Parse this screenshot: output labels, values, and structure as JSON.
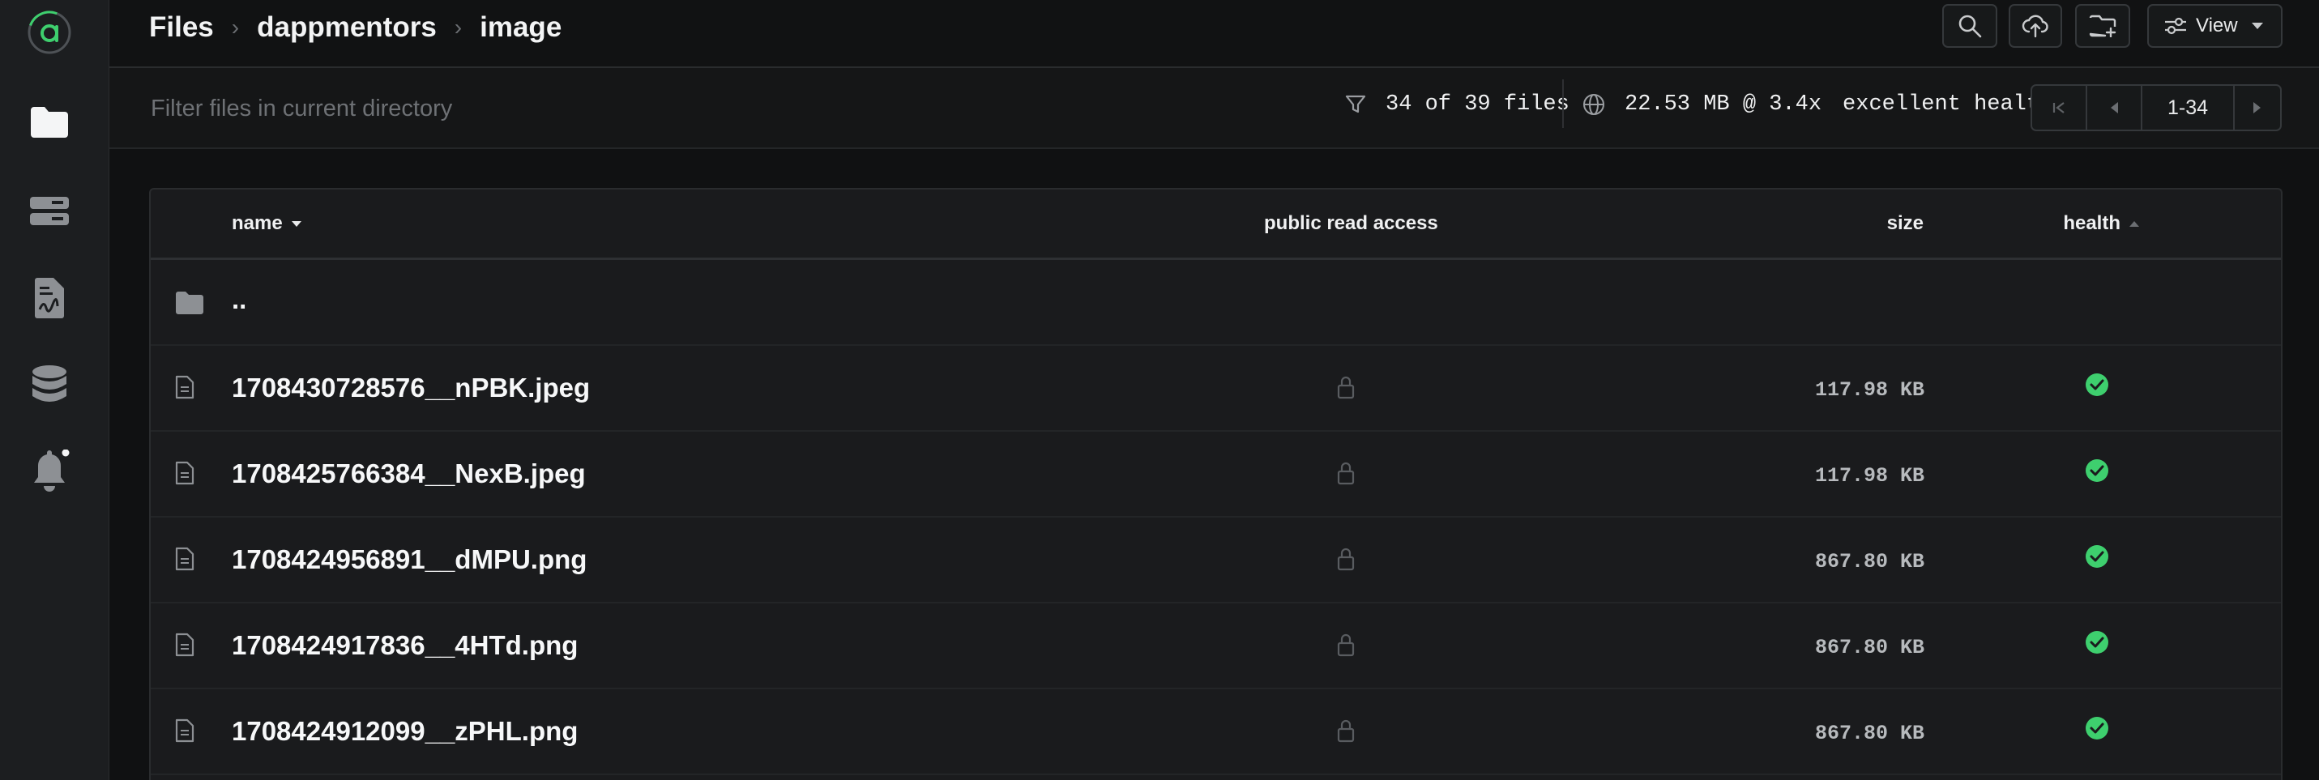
{
  "breadcrumb": [
    "Files",
    "dappmentors",
    "image"
  ],
  "toolbar": {
    "view_label": "View"
  },
  "filter": {
    "placeholder": "Filter files in current directory",
    "count_text": "34 of 39 files",
    "storage_text": "22.53 MB @ 3.4x",
    "health_text": "excellent health",
    "page_range": "1-34"
  },
  "table": {
    "columns": {
      "name": "name",
      "public": "public read access",
      "size": "size",
      "health": "health"
    },
    "parent_label": "..",
    "rows": [
      {
        "name": "1708430728576__nPBK.jpeg",
        "size": "117.98 KB",
        "health": "excellent"
      },
      {
        "name": "1708425766384__NexB.jpeg",
        "size": "117.98 KB",
        "health": "excellent"
      },
      {
        "name": "1708424956891__dMPU.png",
        "size": "867.80 KB",
        "health": "excellent"
      },
      {
        "name": "1708424917836__4HTd.png",
        "size": "867.80 KB",
        "health": "excellent"
      },
      {
        "name": "1708424912099__zPHL.png",
        "size": "867.80 KB",
        "health": "excellent"
      }
    ]
  },
  "sidebar": {
    "items": [
      {
        "icon": "app-logo-icon"
      },
      {
        "icon": "folder-icon",
        "active": true
      },
      {
        "icon": "hosts-icon"
      },
      {
        "icon": "contracts-icon"
      },
      {
        "icon": "database-icon"
      },
      {
        "icon": "bell-icon",
        "has_dot": true
      }
    ]
  },
  "colors": {
    "accent": "#3ecf6e",
    "background": "#101112",
    "panel": "#1a1b1d"
  }
}
